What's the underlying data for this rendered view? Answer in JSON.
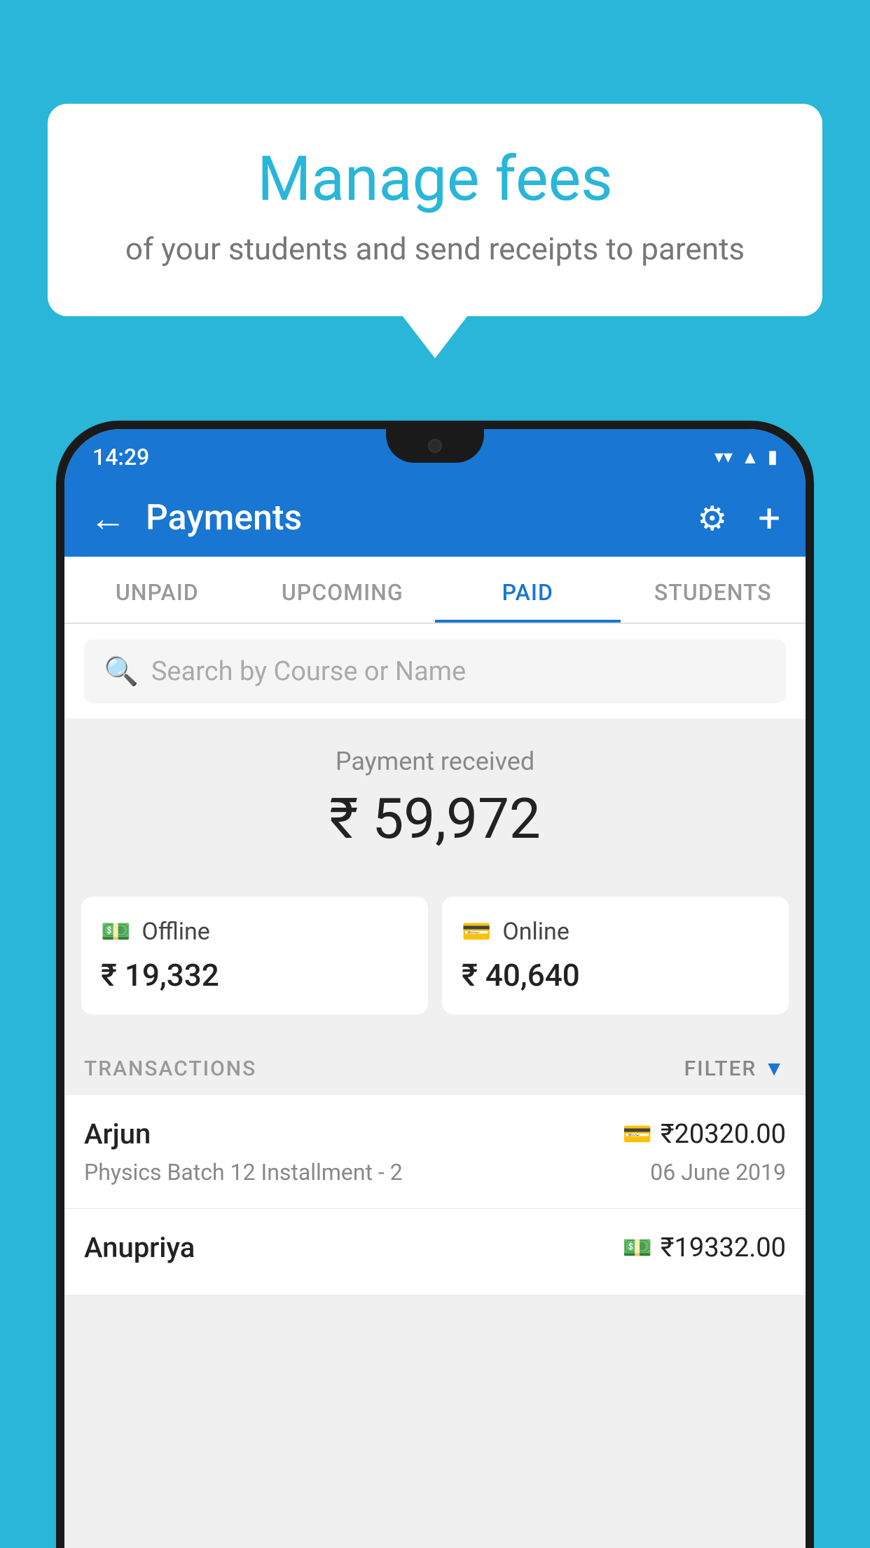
{
  "background_color": "#29b6d8",
  "speech_bubble": {
    "title": "Manage fees",
    "subtitle": "of your students and send receipts to parents"
  },
  "status_bar": {
    "time": "14:29",
    "icons": [
      "wifi",
      "signal",
      "battery"
    ]
  },
  "header": {
    "title": "Payments",
    "back_label": "←",
    "gear_label": "⚙",
    "plus_label": "+"
  },
  "tabs": [
    {
      "label": "UNPAID",
      "active": false
    },
    {
      "label": "UPCOMING",
      "active": false
    },
    {
      "label": "PAID",
      "active": true
    },
    {
      "label": "STUDENTS",
      "active": false
    }
  ],
  "search": {
    "placeholder": "Search by Course or Name"
  },
  "payment_section": {
    "label": "Payment received",
    "amount": "₹ 59,972",
    "offline_label": "Offline",
    "offline_amount": "₹ 19,332",
    "online_label": "Online",
    "online_amount": "₹ 40,640"
  },
  "transactions": {
    "header_label": "TRANSACTIONS",
    "filter_label": "FILTER",
    "items": [
      {
        "name": "Arjun",
        "amount": "₹20320.00",
        "course": "Physics Batch 12 Installment - 2",
        "date": "06 June 2019",
        "payment_type": "card"
      },
      {
        "name": "Anupriya",
        "amount": "₹19332.00",
        "course": "",
        "date": "",
        "payment_type": "cash"
      }
    ]
  }
}
